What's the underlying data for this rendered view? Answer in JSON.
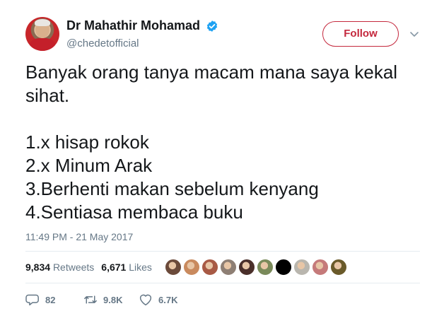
{
  "user": {
    "display_name": "Dr Mahathir Mohamad",
    "handle": "@chedetofficial",
    "verified": true,
    "avatar_icon": "profile-photo"
  },
  "follow_button": {
    "label": "Follow",
    "color": "#c4283d"
  },
  "menu_icon": "chevron-down-icon",
  "tweet": {
    "text": "Banyak orang tanya macam mana saya kekal sihat.\n\n1.x hisap rokok\n2.x Minum Arak\n3.Berhenti makan sebelum kenyang\n4.Sentiasa membaca buku",
    "timestamp": "11:49 PM - 21 May 2017"
  },
  "stats": {
    "retweets_count": "9,834",
    "retweets_label": "Retweets",
    "likes_count": "6,671",
    "likes_label": "Likes"
  },
  "liker_avatars": [
    {
      "color": "#6b4a3a"
    },
    {
      "color": "#c98a5e"
    },
    {
      "color": "#a85a45"
    },
    {
      "color": "#8e7f74"
    },
    {
      "color": "#4a2f2a"
    },
    {
      "color": "#7a8a5a"
    },
    {
      "color": "#000000"
    },
    {
      "color": "#b9b6ae"
    },
    {
      "color": "#c57a7a"
    },
    {
      "color": "#6a5a2a"
    }
  ],
  "actions": {
    "reply_count": "82",
    "retweet_count": "9.8K",
    "like_count": "6.7K"
  },
  "colors": {
    "accent": "#c4283d",
    "verified": "#1da1f2",
    "secondary_text": "#657786"
  }
}
